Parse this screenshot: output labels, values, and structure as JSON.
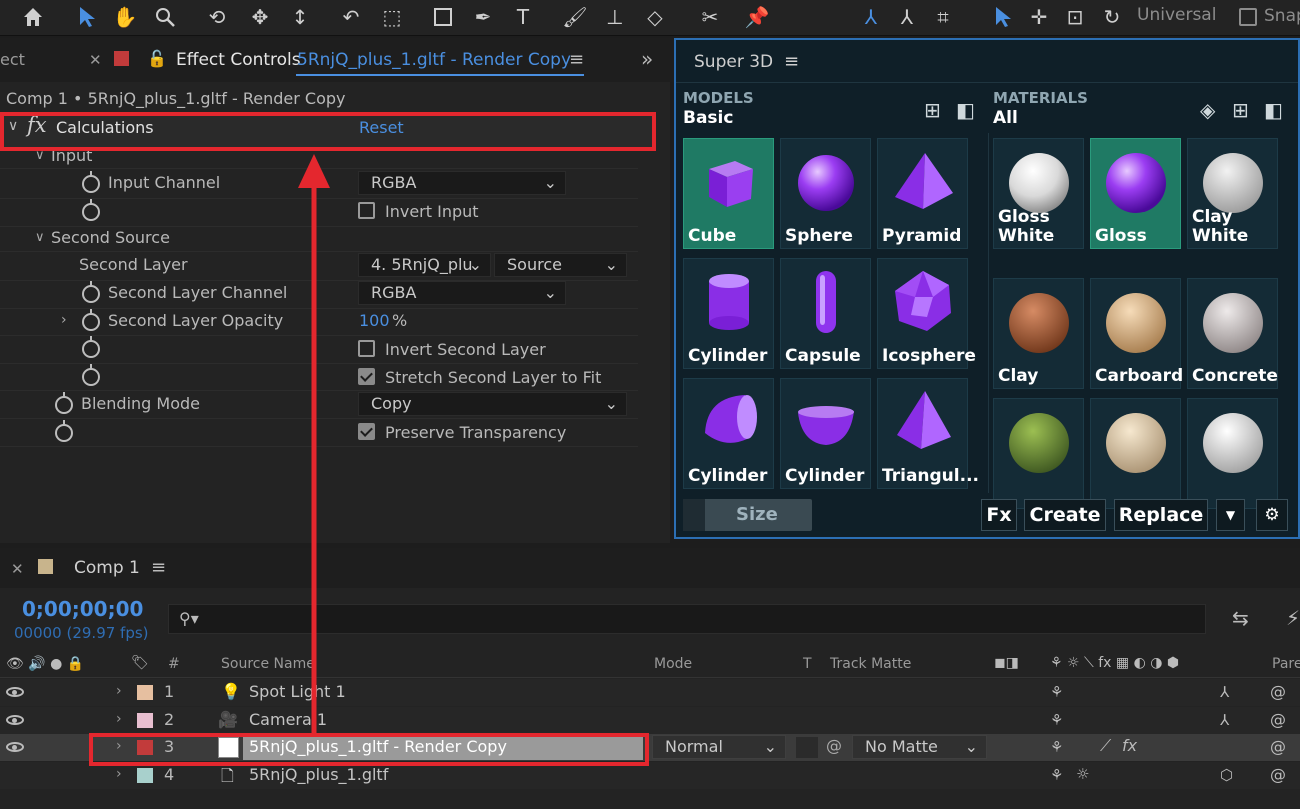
{
  "toolbar": {
    "universal": "Universal",
    "snap": "Snap"
  },
  "effect_panel": {
    "left_tab": "ect",
    "tab_title": "Effect Controls",
    "tab_layer": "5RnjQ_plus_1.gltf - Render Copy",
    "breadcrumb": "Comp 1 • 5RnjQ_plus_1.gltf - Render Copy",
    "effect_name": "Calculations",
    "reset": "Reset",
    "group_input": "Input",
    "input_channel": "Input Channel",
    "input_channel_value": "RGBA",
    "invert_input": "Invert Input",
    "group_second": "Second Source",
    "second_layer": "Second Layer",
    "second_layer_value": "4. 5RnjQ_plu",
    "second_layer_source": "Source",
    "second_layer_channel": "Second Layer Channel",
    "second_layer_channel_value": "RGBA",
    "second_layer_opacity": "Second Layer Opacity",
    "opacity_value": "100",
    "opacity_unit": "%",
    "invert_second": "Invert Second Layer",
    "stretch_second": "Stretch Second Layer to Fit",
    "blending_mode": "Blending Mode",
    "blending_value": "Copy",
    "preserve": "Preserve Transparency"
  },
  "super3d": {
    "title": "Super 3D",
    "models_header": "MODELS",
    "models_sub": "Basic",
    "materials_header": "MATERIALS",
    "materials_sub": "All",
    "models": [
      "Cube",
      "Sphere",
      "Pyramid",
      "Cylinder",
      "Capsule",
      "Icosphere",
      "Cylinder",
      "Cylinder",
      "Triangul..."
    ],
    "materials": [
      "Gloss White",
      "Gloss",
      "Clay White",
      "Clay",
      "Carboard",
      "Concrete",
      "",
      "",
      ""
    ],
    "size": "Size",
    "fx": "Fx",
    "create": "Create",
    "replace": "Replace"
  },
  "timeline": {
    "comp_tab": "Comp 1",
    "timecode": "0;00;00;00",
    "fps": "00000 (29.97 fps)",
    "search_prefix": "⚲▾",
    "col_num": "#",
    "col_source": "Source Name",
    "col_mode": "Mode",
    "col_t": "T",
    "col_matte": "Track Matte",
    "col_parent": "Pare",
    "layers": [
      {
        "num": "1",
        "name": "Spot Light 1"
      },
      {
        "num": "2",
        "name": "Camera 1"
      },
      {
        "num": "3",
        "name": "5RnjQ_plus_1.gltf - Render Copy",
        "mode": "Normal",
        "matte": "No Matte"
      },
      {
        "num": "4",
        "name": "5RnjQ_plus_1.gltf"
      }
    ]
  },
  "colors": {
    "accent_blue": "#4a8fe0",
    "highlight_red": "#e4272e",
    "selected_green": "#1f7a64"
  }
}
